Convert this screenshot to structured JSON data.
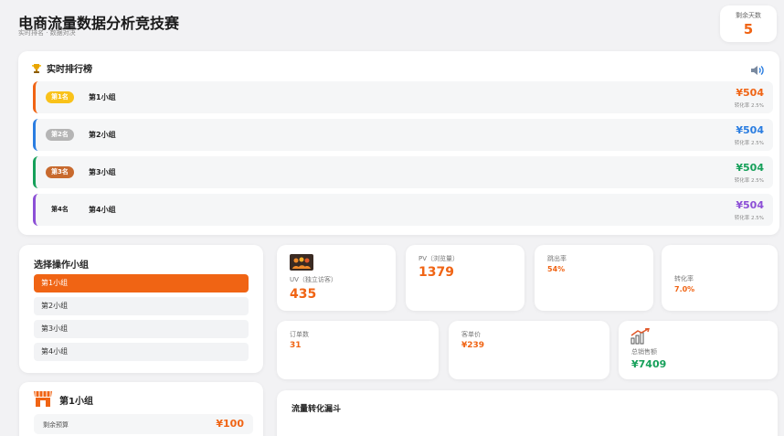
{
  "header": {
    "title": "电商流量数据分析竞技赛",
    "subtitle": "实时排名 · 数据对决"
  },
  "days": {
    "label": "剩余天数",
    "value": "5"
  },
  "ranking": {
    "title": "实时排行榜",
    "rows": [
      {
        "badge": "第1名",
        "name": "第1小组",
        "money": "¥504",
        "conv": "转化率 2.5%",
        "color": "#f06414",
        "badge_bg": "#f9c21a"
      },
      {
        "badge": "第2名",
        "name": "第2小组",
        "money": "¥504",
        "conv": "转化率 2.5%",
        "color": "#2a7de1",
        "badge_bg": "#b5b5b5"
      },
      {
        "badge": "第3名",
        "name": "第3小组",
        "money": "¥504",
        "conv": "转化率 2.5%",
        "color": "#16a05a",
        "badge_bg": "#c86a2e"
      },
      {
        "badge": "第4名",
        "name": "第4小组",
        "money": "¥504",
        "conv": "转化率 2.5%",
        "color": "#8c4fd6",
        "badge_bg": ""
      }
    ]
  },
  "select": {
    "title": "选择操作小组",
    "groups": [
      "第1小组",
      "第2小组",
      "第3小组",
      "第4小组"
    ],
    "active_index": 0
  },
  "stats": {
    "uv": {
      "label": "UV（独立访客）",
      "value": "435"
    },
    "pv": {
      "label": "PV（浏览量）",
      "value": "1379"
    },
    "bounce": {
      "label": "跳出率",
      "value": "54%"
    },
    "conversion": {
      "label": "转化率",
      "value": "7.0%"
    },
    "orders": {
      "label": "订单数",
      "value": "31"
    },
    "aov": {
      "label": "客单价",
      "value": "¥239"
    },
    "sales": {
      "label": "总销售额",
      "value": "¥7409"
    }
  },
  "budget": {
    "group": "第1小组",
    "label": "剩余预算",
    "value": "¥100"
  },
  "funnel": {
    "title": "流量转化漏斗"
  },
  "colors": {
    "accent": "#f06414",
    "green": "#16a05a"
  }
}
